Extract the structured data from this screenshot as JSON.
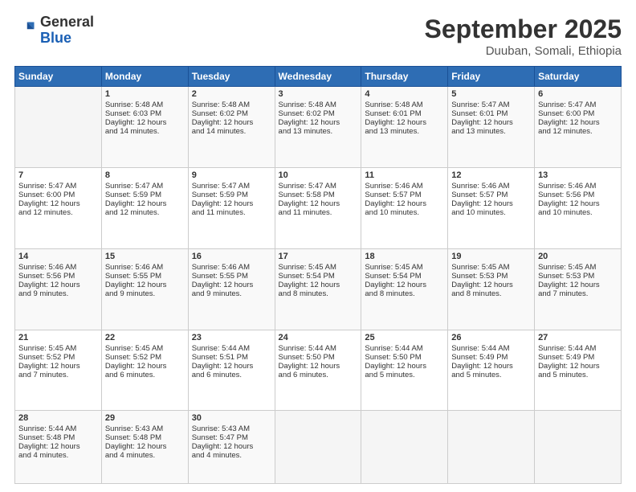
{
  "header": {
    "logo_general": "General",
    "logo_blue": "Blue",
    "title": "September 2025",
    "subtitle": "Duuban, Somali, Ethiopia"
  },
  "weekdays": [
    "Sunday",
    "Monday",
    "Tuesday",
    "Wednesday",
    "Thursday",
    "Friday",
    "Saturday"
  ],
  "weeks": [
    [
      {
        "day": "",
        "info": ""
      },
      {
        "day": "1",
        "info": "Sunrise: 5:48 AM\nSunset: 6:03 PM\nDaylight: 12 hours\nand 14 minutes."
      },
      {
        "day": "2",
        "info": "Sunrise: 5:48 AM\nSunset: 6:02 PM\nDaylight: 12 hours\nand 14 minutes."
      },
      {
        "day": "3",
        "info": "Sunrise: 5:48 AM\nSunset: 6:02 PM\nDaylight: 12 hours\nand 13 minutes."
      },
      {
        "day": "4",
        "info": "Sunrise: 5:48 AM\nSunset: 6:01 PM\nDaylight: 12 hours\nand 13 minutes."
      },
      {
        "day": "5",
        "info": "Sunrise: 5:47 AM\nSunset: 6:01 PM\nDaylight: 12 hours\nand 13 minutes."
      },
      {
        "day": "6",
        "info": "Sunrise: 5:47 AM\nSunset: 6:00 PM\nDaylight: 12 hours\nand 12 minutes."
      }
    ],
    [
      {
        "day": "7",
        "info": "Sunrise: 5:47 AM\nSunset: 6:00 PM\nDaylight: 12 hours\nand 12 minutes."
      },
      {
        "day": "8",
        "info": "Sunrise: 5:47 AM\nSunset: 5:59 PM\nDaylight: 12 hours\nand 12 minutes."
      },
      {
        "day": "9",
        "info": "Sunrise: 5:47 AM\nSunset: 5:59 PM\nDaylight: 12 hours\nand 11 minutes."
      },
      {
        "day": "10",
        "info": "Sunrise: 5:47 AM\nSunset: 5:58 PM\nDaylight: 12 hours\nand 11 minutes."
      },
      {
        "day": "11",
        "info": "Sunrise: 5:46 AM\nSunset: 5:57 PM\nDaylight: 12 hours\nand 10 minutes."
      },
      {
        "day": "12",
        "info": "Sunrise: 5:46 AM\nSunset: 5:57 PM\nDaylight: 12 hours\nand 10 minutes."
      },
      {
        "day": "13",
        "info": "Sunrise: 5:46 AM\nSunset: 5:56 PM\nDaylight: 12 hours\nand 10 minutes."
      }
    ],
    [
      {
        "day": "14",
        "info": "Sunrise: 5:46 AM\nSunset: 5:56 PM\nDaylight: 12 hours\nand 9 minutes."
      },
      {
        "day": "15",
        "info": "Sunrise: 5:46 AM\nSunset: 5:55 PM\nDaylight: 12 hours\nand 9 minutes."
      },
      {
        "day": "16",
        "info": "Sunrise: 5:46 AM\nSunset: 5:55 PM\nDaylight: 12 hours\nand 9 minutes."
      },
      {
        "day": "17",
        "info": "Sunrise: 5:45 AM\nSunset: 5:54 PM\nDaylight: 12 hours\nand 8 minutes."
      },
      {
        "day": "18",
        "info": "Sunrise: 5:45 AM\nSunset: 5:54 PM\nDaylight: 12 hours\nand 8 minutes."
      },
      {
        "day": "19",
        "info": "Sunrise: 5:45 AM\nSunset: 5:53 PM\nDaylight: 12 hours\nand 8 minutes."
      },
      {
        "day": "20",
        "info": "Sunrise: 5:45 AM\nSunset: 5:53 PM\nDaylight: 12 hours\nand 7 minutes."
      }
    ],
    [
      {
        "day": "21",
        "info": "Sunrise: 5:45 AM\nSunset: 5:52 PM\nDaylight: 12 hours\nand 7 minutes."
      },
      {
        "day": "22",
        "info": "Sunrise: 5:45 AM\nSunset: 5:52 PM\nDaylight: 12 hours\nand 6 minutes."
      },
      {
        "day": "23",
        "info": "Sunrise: 5:44 AM\nSunset: 5:51 PM\nDaylight: 12 hours\nand 6 minutes."
      },
      {
        "day": "24",
        "info": "Sunrise: 5:44 AM\nSunset: 5:50 PM\nDaylight: 12 hours\nand 6 minutes."
      },
      {
        "day": "25",
        "info": "Sunrise: 5:44 AM\nSunset: 5:50 PM\nDaylight: 12 hours\nand 5 minutes."
      },
      {
        "day": "26",
        "info": "Sunrise: 5:44 AM\nSunset: 5:49 PM\nDaylight: 12 hours\nand 5 minutes."
      },
      {
        "day": "27",
        "info": "Sunrise: 5:44 AM\nSunset: 5:49 PM\nDaylight: 12 hours\nand 5 minutes."
      }
    ],
    [
      {
        "day": "28",
        "info": "Sunrise: 5:44 AM\nSunset: 5:48 PM\nDaylight: 12 hours\nand 4 minutes."
      },
      {
        "day": "29",
        "info": "Sunrise: 5:43 AM\nSunset: 5:48 PM\nDaylight: 12 hours\nand 4 minutes."
      },
      {
        "day": "30",
        "info": "Sunrise: 5:43 AM\nSunset: 5:47 PM\nDaylight: 12 hours\nand 4 minutes."
      },
      {
        "day": "",
        "info": ""
      },
      {
        "day": "",
        "info": ""
      },
      {
        "day": "",
        "info": ""
      },
      {
        "day": "",
        "info": ""
      }
    ]
  ]
}
